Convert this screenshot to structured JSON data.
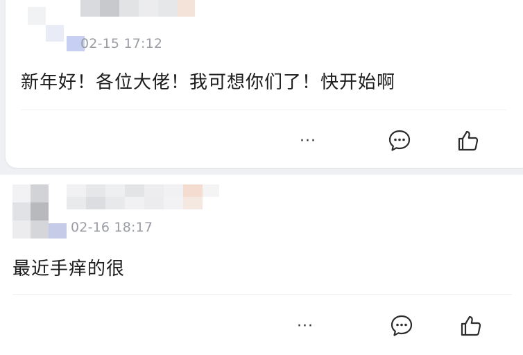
{
  "comments": [
    {
      "time": "02-15 17:12",
      "content": "新年好！各位大佬！我可想你们了！快开始啊",
      "more_label": "···"
    },
    {
      "time": "02-16 18:17",
      "content": "最近手痒的很",
      "more_label": "···"
    }
  ],
  "icons": [
    "more-icon",
    "comment-icon",
    "like-icon"
  ]
}
